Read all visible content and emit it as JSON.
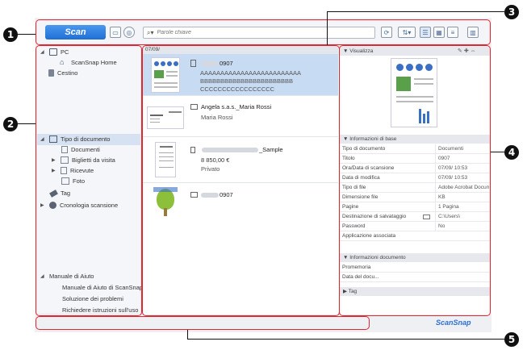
{
  "toolbar": {
    "scan_label": "Scan",
    "search_placeholder": "Parole chiave"
  },
  "sidebar": {
    "top_items": [
      {
        "label": "PC"
      },
      {
        "label": "ScanSnap Home"
      },
      {
        "label": "Cestino"
      }
    ],
    "group_items": [
      {
        "label": "Tipo di documento"
      },
      {
        "label": "Documenti"
      },
      {
        "label": "Biglietti da visita"
      },
      {
        "label": "Ricevute"
      },
      {
        "label": "Foto"
      },
      {
        "label": "Tag"
      },
      {
        "label": "Cronologia scansione"
      }
    ],
    "help_items": [
      {
        "label": "Manuale di Aiuto"
      },
      {
        "label": "Manuale di Aiuto di ScanSnap"
      },
      {
        "label": "Soluzione dei problemi"
      },
      {
        "label": "Richiedere istruzioni sull'uso"
      }
    ]
  },
  "list": {
    "date_header": "07/09/",
    "rows": [
      {
        "title_suffix": "0907",
        "line1": "AAAAAAAAAAAAAAAAAAAAAAAAA",
        "line2": "BBBBBBBBBBBBBBBBBBBBBBB",
        "line3": "CCCCCCCCCCCCCCCCC"
      },
      {
        "title": "Angela s.a.s._Maria Rossi",
        "sub": "Maria Rossi"
      },
      {
        "title_suffix": "_Sample",
        "amount": "8 850,00 €",
        "category": "Privato"
      },
      {
        "title_suffix": "0907"
      }
    ]
  },
  "details": {
    "preview_header": "Visualizza",
    "basic_header": "Informazioni di base",
    "rows": [
      {
        "key": "Tipo di documento",
        "value": "Documenti"
      },
      {
        "key": "Titolo",
        "value": "0907"
      },
      {
        "key": "Ora/Data di scansione",
        "value": "07/09/  10:53"
      },
      {
        "key": "Data di modifica",
        "value": "07/09/  10:53"
      },
      {
        "key": "Tipo di file",
        "value": "Adobe Acrobat Docume"
      },
      {
        "key": "Dimensione file",
        "value": "KB"
      },
      {
        "key": "Pagine",
        "value": "1 Pagina"
      },
      {
        "key": "Destinazione di salvataggio",
        "value": "C:\\Users\\"
      },
      {
        "key": "Password",
        "value": "No"
      },
      {
        "key": "Applicazione associata",
        "value": ""
      }
    ],
    "doc_info_header": "Informazioni documento",
    "doc_rows": [
      {
        "key": "Promemoria",
        "value": ""
      },
      {
        "key": "Data del docu...",
        "value": ""
      }
    ],
    "tag_header": "Tag"
  },
  "brand": "ScanSnap",
  "callouts": [
    "1",
    "2",
    "3",
    "4",
    "5"
  ]
}
